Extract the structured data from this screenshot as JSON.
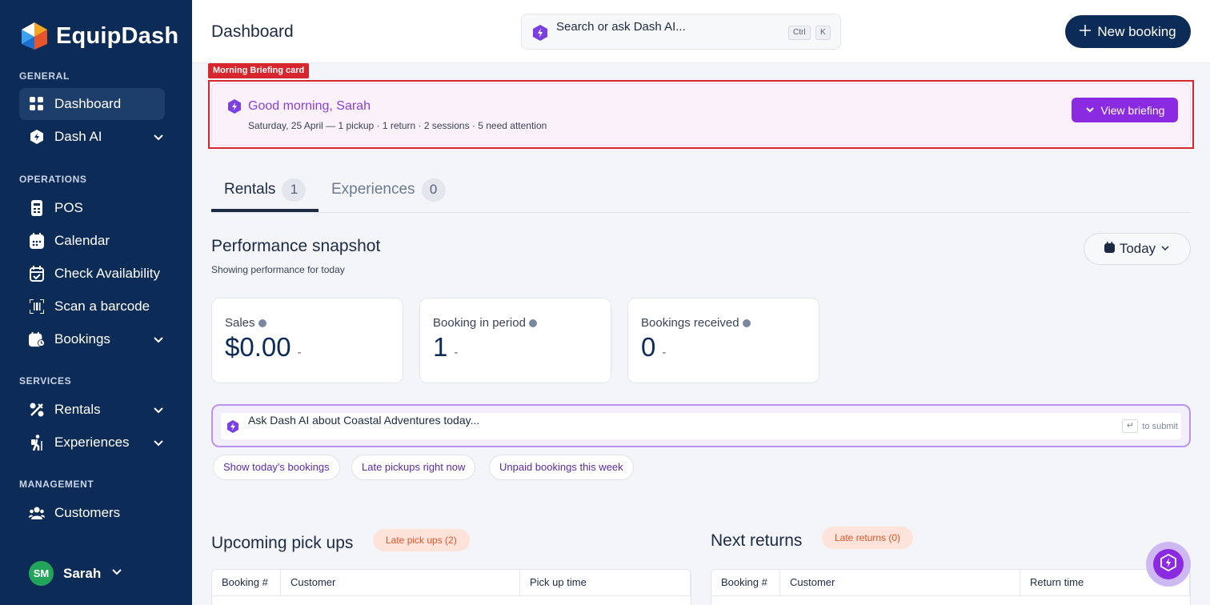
{
  "app": {
    "name": "EquipDash"
  },
  "colors": {
    "sidebar": "#0d2b57",
    "accent": "#8a2be2",
    "highlight": "#d7262e",
    "late": "#e0542b"
  },
  "sidebar": {
    "sections": [
      {
        "label": "GENERAL"
      },
      {
        "label": "OPERATIONS"
      },
      {
        "label": "SERVICES"
      },
      {
        "label": "MANAGEMENT"
      }
    ],
    "items": [
      {
        "label": "Dashboard",
        "icon": "grid-icon"
      },
      {
        "label": "Dash AI",
        "icon": "ai-hex-icon"
      },
      {
        "label": "POS",
        "icon": "pos-icon"
      },
      {
        "label": "Calendar",
        "icon": "calendar-icon"
      },
      {
        "label": "Check Availability",
        "icon": "calendar-check-icon"
      },
      {
        "label": "Scan a barcode",
        "icon": "barcode-icon"
      },
      {
        "label": "Bookings",
        "icon": "bookings-icon"
      },
      {
        "label": "Rentals",
        "icon": "rentals-icon"
      },
      {
        "label": "Experiences",
        "icon": "hiker-icon"
      },
      {
        "label": "Customers",
        "icon": "users-icon"
      }
    ],
    "user": {
      "initials": "SM",
      "name": "Sarah"
    }
  },
  "header": {
    "title": "Dashboard",
    "search_placeholder": "Search or ask Dash AI...",
    "kbd_ctrl": "Ctrl",
    "kbd_k": "K",
    "new_booking": "New booking"
  },
  "briefing": {
    "tag": "Morning Briefing card",
    "title": "Good morning, Sarah",
    "subtitle": "Saturday, 25 April — 1 pickup · 1 return · 2 sessions · 5 need attention",
    "button": "View briefing"
  },
  "tabs": [
    {
      "label": "Rentals",
      "count": "1"
    },
    {
      "label": "Experiences",
      "count": "0"
    }
  ],
  "performance": {
    "title": "Performance snapshot",
    "subtitle": "Showing performance for today",
    "period": "Today",
    "stats": [
      {
        "label": "Sales",
        "value": "$0.00",
        "delta": "-"
      },
      {
        "label": "Booking in period",
        "value": "1",
        "delta": "-"
      },
      {
        "label": "Bookings received",
        "value": "0",
        "delta": "-"
      }
    ]
  },
  "ask": {
    "text": "Ask Dash AI about Coastal Adventures today...",
    "hint": "to submit",
    "chips": [
      "Show today's bookings",
      "Late pickups right now",
      "Unpaid bookings this week"
    ]
  },
  "pickups": {
    "title": "Upcoming pick ups",
    "badge": "Late pick ups (2)",
    "columns": [
      "Booking #",
      "Customer",
      "Pick up time"
    ]
  },
  "returns": {
    "title": "Next returns",
    "badge": "Late returns (0)",
    "columns": [
      "Booking #",
      "Customer",
      "Return time"
    ]
  }
}
